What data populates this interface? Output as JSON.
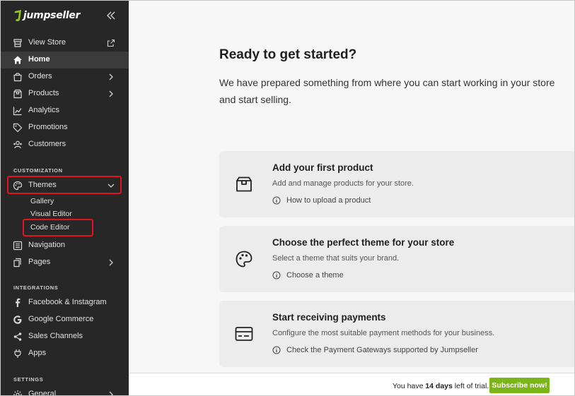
{
  "brand": {
    "name": "jumpseller",
    "color": "#8fd014"
  },
  "sidebar": {
    "collapse_icon": "double-chevron-left-icon",
    "top_items": [
      {
        "label": "View Store",
        "icon": "store-icon",
        "trailing": "external-link-icon"
      },
      {
        "label": "Home",
        "icon": "home-icon",
        "active": true
      },
      {
        "label": "Orders",
        "icon": "shopping-bag-icon",
        "trailing": "chevron-right-icon"
      },
      {
        "label": "Products",
        "icon": "box-icon",
        "trailing": "chevron-right-icon"
      },
      {
        "label": "Analytics",
        "icon": "chart-line-icon"
      },
      {
        "label": "Promotions",
        "icon": "tag-icon"
      },
      {
        "label": "Customers",
        "icon": "users-icon"
      }
    ],
    "customization_title": "CUSTOMIZATION",
    "themes": {
      "label": "Themes",
      "icon": "palette-icon",
      "trailing": "chevron-down-icon"
    },
    "themes_sub": [
      "Gallery",
      "Visual Editor",
      "Code Editor"
    ],
    "customization_items": [
      {
        "label": "Navigation",
        "icon": "list-icon"
      },
      {
        "label": "Pages",
        "icon": "pages-icon",
        "trailing": "chevron-right-icon"
      }
    ],
    "integrations_title": "INTEGRATIONS",
    "integration_items": [
      {
        "label": "Facebook & Instagram",
        "icon": "facebook-icon"
      },
      {
        "label": "Google Commerce",
        "icon": "google-icon"
      },
      {
        "label": "Sales Channels",
        "icon": "share-icon"
      },
      {
        "label": "Apps",
        "icon": "plug-icon"
      }
    ],
    "settings_title": "SETTINGS",
    "settings_items": [
      {
        "label": "General",
        "icon": "gear-icon",
        "trailing": "chevron-right-icon"
      }
    ],
    "highlight_color": "#e5131d"
  },
  "main": {
    "heading": "Ready to get started?",
    "intro": "We have prepared something from where you can start working in your store and start selling.",
    "cards": [
      {
        "title": "Add your first product",
        "desc": "Add and manage products for your store.",
        "link": "How to upload a product",
        "icon": "box-icon"
      },
      {
        "title": "Choose the perfect theme for your store",
        "desc": "Select a theme that suits your brand.",
        "link": "Choose a theme",
        "icon": "palette-icon"
      },
      {
        "title": "Start receiving payments",
        "desc": "Configure the most suitable payment methods for your business.",
        "link": "Check the Payment Gateways supported by Jumpseller",
        "icon": "credit-card-icon"
      }
    ]
  },
  "trial": {
    "text_before": "You have ",
    "days": "14 days",
    "text_after": " left of trial.",
    "button": "Subscribe now!",
    "button_color": "#7cb518"
  }
}
